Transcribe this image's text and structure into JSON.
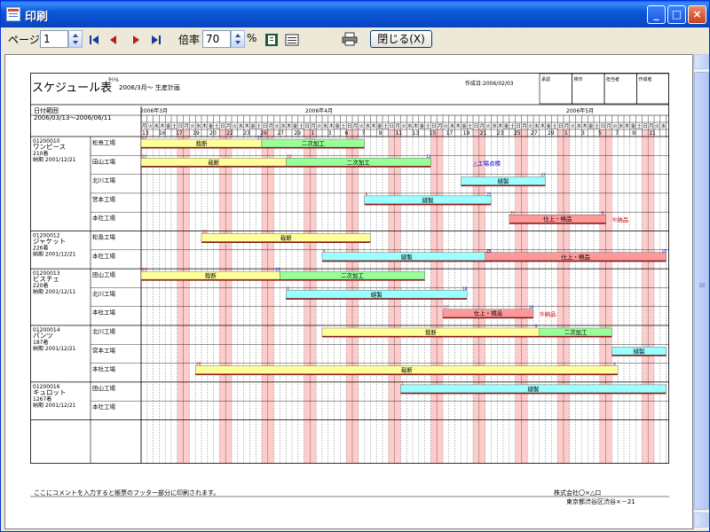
{
  "window": {
    "title": "印刷"
  },
  "toolbar": {
    "page_label": "ページ",
    "page_value": "1",
    "zoom_label": "倍率",
    "zoom_value": "70",
    "zoom_unit": "%",
    "close_label": "閉じる(X)",
    "icons": [
      "first-page-icon",
      "prev-page-icon",
      "next-page-icon",
      "last-page-icon",
      "one-page-view-icon",
      "multi-page-view-icon",
      "printer-icon"
    ]
  },
  "report": {
    "title": "スケジュール表",
    "subtitle_small": "ﾀｲﾄﾙ",
    "subtitle": "2006/3月～ 生産計画",
    "created": "作成日:2006/02/03",
    "stamp_labels": [
      "承認",
      "検印",
      "担当者",
      "作成者"
    ],
    "range_title": "日付範囲",
    "range": "2006/03/13～2006/06/11",
    "months": [
      "2006年3月",
      "2006年4月",
      "2006年5月"
    ],
    "footer_comment": "ここにコメントを入力すると帳票のフッター部分に印刷されます。",
    "company": "株式会社〇×△口",
    "address": "東京都渋谷区渋谷×－21"
  },
  "calendar": {
    "weekdays": [
      "月",
      "火",
      "水",
      "木",
      "金",
      "土",
      "日",
      "月",
      "火",
      "水",
      "木",
      "金",
      "土",
      "日",
      "月",
      "火",
      "水",
      "木",
      "金",
      "土",
      "日",
      "月",
      "火",
      "水",
      "木",
      "金",
      "土",
      "日",
      "月",
      "火",
      "水",
      "木",
      "金",
      "土",
      "日",
      "月",
      "火",
      "水",
      "木",
      "金",
      "土",
      "日",
      "月",
      "火",
      "水",
      "木",
      "金",
      "土",
      "日",
      "月",
      "火",
      "水",
      "木",
      "金",
      "土",
      "日",
      "月",
      "火",
      "水",
      "木",
      "金",
      "土",
      "日",
      "月",
      "火",
      "水",
      "木",
      "金",
      "土",
      "日",
      "月",
      "火",
      "水",
      "木",
      "金",
      "土",
      "日",
      "月",
      "火",
      "水",
      "木",
      "金",
      "土",
      "日",
      "月",
      "火",
      "水"
    ],
    "date_labels": [
      "13",
      "16",
      "17",
      "19",
      "20",
      "22",
      "23",
      "26",
      "27",
      "29",
      "1",
      "3",
      "6",
      "7",
      "9",
      "11",
      "13",
      "15",
      "17",
      "19",
      "21",
      "23",
      "25",
      "27",
      "29",
      "1",
      "3",
      "5",
      "7",
      "9",
      "11"
    ],
    "holiday_columns": [
      6,
      7,
      13,
      14,
      20,
      21,
      27,
      28,
      34,
      35,
      41,
      42,
      48,
      49,
      55,
      56,
      62,
      63,
      69,
      70,
      76,
      77,
      83,
      84
    ]
  },
  "orders": [
    {
      "code": "01200010",
      "name": "ワンピース",
      "qty": "210着",
      "due": "納期 2001/12/21",
      "factories": [
        "松島工場",
        "田山工場",
        "北川工場",
        "宮本工場",
        "本社工場"
      ]
    },
    {
      "code": "01200012",
      "name": "ジャケット",
      "qty": "226着",
      "due": "納期 2001/12/21",
      "factories": [
        "松島工場",
        "本社工場"
      ]
    },
    {
      "code": "01200013",
      "name": "ビスチェ",
      "qty": "220着",
      "due": "納期 2001/12/11",
      "factories": [
        "田山工場",
        "北川工場",
        "本社工場"
      ]
    },
    {
      "code": "01200014",
      "name": "パンツ",
      "qty": "187着",
      "due": "納期 2001/12/21",
      "factories": [
        "北川工場",
        "宮本工場",
        "本社工場"
      ]
    },
    {
      "code": "01200016",
      "name": "キュロット",
      "qty": "1267着",
      "due": "納期 2001/12/21",
      "factories": [
        "田山工場",
        "本社工場"
      ]
    }
  ],
  "bars": [
    {
      "label": "裁断",
      "color": "#ffff99",
      "row": 0,
      "start": 0,
      "end": 19,
      "s": "20",
      "e": "27"
    },
    {
      "label": "二次加工",
      "color": "#99ff99",
      "row": 0,
      "start": 20,
      "end": 36,
      "s": "",
      "e": ""
    },
    {
      "label": "裁断",
      "color": "#ffff99",
      "row": 1,
      "start": 0,
      "end": 23,
      "s": "22",
      "e": ""
    },
    {
      "label": "二次加工",
      "color": "#99ff99",
      "row": 1,
      "start": 24,
      "end": 47,
      "s": "23",
      "e": "13"
    },
    {
      "label": "縫製",
      "color": "#99ffff",
      "row": 2,
      "start": 53,
      "end": 66,
      "s": "",
      "e": "27"
    },
    {
      "label": "縫製",
      "color": "#99ffff",
      "row": 3,
      "start": 37,
      "end": 57,
      "s": "6",
      "e": "25"
    },
    {
      "label": "仕上・検品",
      "color": "#ff9999",
      "row": 4,
      "start": 61,
      "end": 76,
      "s": "30",
      "e": "9"
    },
    {
      "label": "裁断",
      "color": "#ffff99",
      "row": 5,
      "start": 10,
      "end": 37,
      "s": "20",
      "e": ""
    },
    {
      "label": "縫製",
      "color": "#99ffff",
      "row": 6,
      "start": 30,
      "end": 57,
      "s": "6",
      "e": "25"
    },
    {
      "label": "仕上・検品",
      "color": "#ff9999",
      "row": 6,
      "start": 57,
      "end": 86,
      "s": "23",
      "e": "19"
    },
    {
      "label": "裁断",
      "color": "#ffff99",
      "row": 7,
      "start": 0,
      "end": 22,
      "s": "23",
      "e": "23"
    },
    {
      "label": "二次加工",
      "color": "#99ff99",
      "row": 7,
      "start": 23,
      "end": 46,
      "s": "",
      "e": ""
    },
    {
      "label": "縫製",
      "color": "#99ffff",
      "row": 8,
      "start": 24,
      "end": 53,
      "s": "6",
      "e": "18"
    },
    {
      "label": "仕上・検品",
      "color": "#ff9999",
      "row": 9,
      "start": 50,
      "end": 64,
      "s": "17",
      "e": "28"
    },
    {
      "label": "裁断",
      "color": "#ffff99",
      "row": 10,
      "start": 30,
      "end": 65,
      "s": "",
      "e": "9"
    },
    {
      "label": "二次加工",
      "color": "#99ff99",
      "row": 10,
      "start": 66,
      "end": 77,
      "s": "",
      "e": ""
    },
    {
      "label": "縫製",
      "color": "#99ffff",
      "row": 11,
      "start": 78,
      "end": 86,
      "s": "",
      "e": ""
    },
    {
      "label": "裁断",
      "color": "#ffff99",
      "row": 12,
      "start": 9,
      "end": 78,
      "s": "29",
      "e": "6"
    },
    {
      "label": "縫製",
      "color": "#99ffff",
      "row": 13,
      "start": 43,
      "end": 86,
      "s": "1",
      "e": ""
    }
  ],
  "annotations": [
    {
      "text": "△工場点検",
      "color": "#0000cc",
      "row": 1,
      "col": 55
    },
    {
      "text": "⑤納品",
      "color": "#cc0000",
      "row": 4,
      "col": 78
    },
    {
      "text": "⑤納品",
      "color": "#cc0000",
      "row": 9,
      "col": 66
    }
  ]
}
